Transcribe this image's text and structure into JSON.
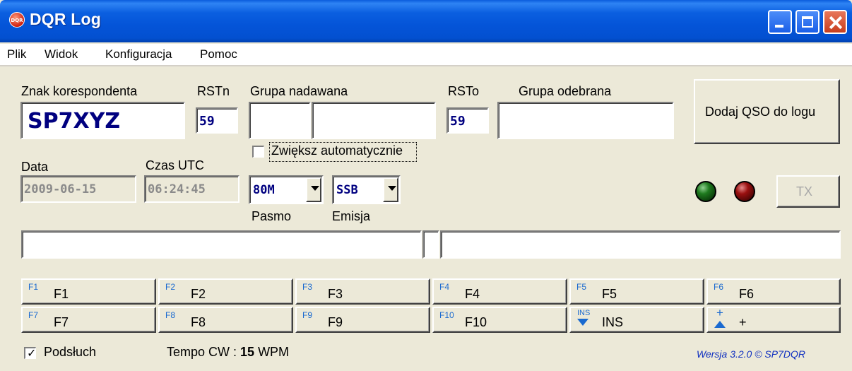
{
  "window": {
    "title": "DQR Log",
    "icon_text": "DQR",
    "titlebar_color": "#0454d8"
  },
  "menu": [
    "Plik",
    "Widok",
    "Konfiguracja",
    "Pomoc"
  ],
  "form": {
    "callsign_label": "Znak korespondenta",
    "callsign_value": "SP7XYZ",
    "rstn_label": "RSTn",
    "rstn_value": "59",
    "group_sent_label": "Grupa nadawana",
    "group_sent_value_a": "",
    "group_sent_value_b": "",
    "rsto_label": "RSTo",
    "rsto_value": "59",
    "group_recv_label": "Grupa odebrana",
    "group_recv_value": "",
    "auto_increment_label": "Zwiększ automatycznie",
    "auto_increment_checked": false,
    "date_label": "Data",
    "date_value": "2009-06-15",
    "time_label": "Czas UTC",
    "time_value": "06:24:45",
    "band_value": "80M",
    "band_label": "Pasmo",
    "mode_value": "SSB",
    "mode_label": "Emisja",
    "add_qso_label": "Dodaj QSO do logu",
    "tx_label": "TX"
  },
  "status": {
    "field_left": "",
    "field_mid": "",
    "field_right": "",
    "led_green": "#1e7a1e",
    "led_red": "#9a1010"
  },
  "fkeys": {
    "row1": [
      {
        "tag": "F1",
        "label": "F1"
      },
      {
        "tag": "F2",
        "label": "F2"
      },
      {
        "tag": "F3",
        "label": "F3"
      },
      {
        "tag": "F4",
        "label": "F4"
      },
      {
        "tag": "F5",
        "label": "F5"
      },
      {
        "tag": "F6",
        "label": "F6"
      }
    ],
    "row2": [
      {
        "tag": "F7",
        "label": "F7"
      },
      {
        "tag": "F8",
        "label": "F8"
      },
      {
        "tag": "F9",
        "label": "F9"
      },
      {
        "tag": "F10",
        "label": "F10"
      },
      {
        "tag": "INS",
        "label": "INS",
        "icon": "arrow-down-icon"
      },
      {
        "tag": "+",
        "label": "+",
        "icon": "arrow-up-icon"
      }
    ],
    "tag_color": "#1a6ad0"
  },
  "footer": {
    "monitor_label": "Podsłuch",
    "monitor_checked": true,
    "cw_speed_prefix": "Tempo CW : ",
    "cw_speed_value": "15",
    "cw_speed_unit": " WPM",
    "version": "Wersja 3.2.0 © SP7DQR"
  }
}
